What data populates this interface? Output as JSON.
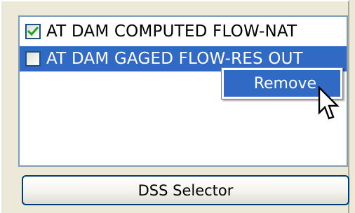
{
  "list": {
    "items": [
      {
        "label": "AT DAM COMPUTED FLOW-NAT",
        "checked": true,
        "selected": false
      },
      {
        "label": "AT DAM GAGED FLOW-RES OUT",
        "checked": false,
        "selected": true
      }
    ]
  },
  "context_menu": {
    "items": [
      {
        "label": "Remove"
      }
    ]
  },
  "buttons": {
    "dss_selector": "DSS Selector"
  },
  "colors": {
    "selection": "#316ac5",
    "panel": "#ece9d8",
    "list_border": "#7f9db9",
    "button_border": "#003c74",
    "checkmark": "#21a121"
  }
}
